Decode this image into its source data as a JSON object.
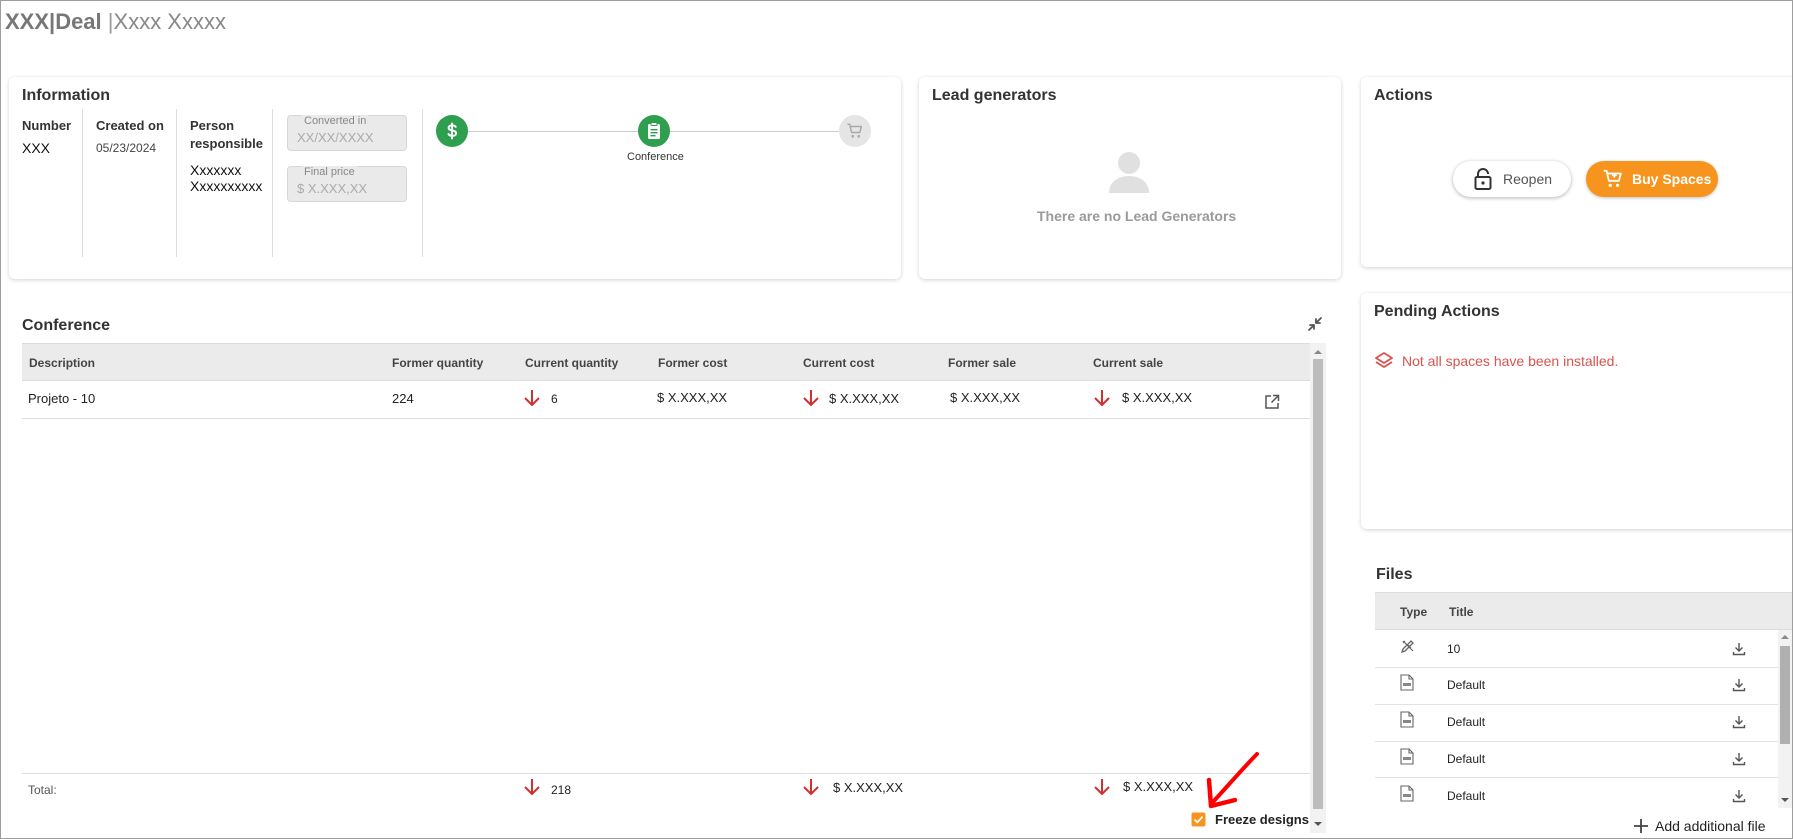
{
  "header": {
    "code": "XXX|",
    "deal": "Deal",
    "separator": "|",
    "client": "Xxxx Xxxxx"
  },
  "information": {
    "title": "Information",
    "number_label": "Number",
    "number_value": "XXX",
    "created_label": "Created on",
    "created_value": "05/23/2024",
    "person_label_1": "Person",
    "person_label_2": "responsible",
    "person_value_1": "Xxxxxxx",
    "person_value_2": "Xxxxxxxxxx",
    "converted_label": "Converted in",
    "converted_value": "XX/XX/XXXX",
    "final_label": "Final price",
    "final_value": "$ X.XXX,XX",
    "stepper": {
      "steps": [
        {
          "icon": "dollar-icon",
          "state": "active"
        },
        {
          "icon": "clipboard-icon",
          "state": "active",
          "label": "Conference"
        },
        {
          "icon": "cart-icon",
          "state": "inactive"
        }
      ],
      "active_color": "#2e9e4f"
    }
  },
  "lead_generators": {
    "title": "Lead generators",
    "empty_icon": "person-icon",
    "empty_text": "There are no Lead Generators"
  },
  "actions": {
    "title": "Actions",
    "reopen_label": "Reopen",
    "reopen_icon": "lock-open-icon",
    "buy_label": "Buy Spaces",
    "buy_icon": "cart-icon",
    "buy_color": "#f7941d"
  },
  "pending_actions": {
    "title": "Pending Actions",
    "items": [
      {
        "icon": "layers-icon",
        "text": "Not all spaces have been installed.",
        "color": "#d9534f"
      }
    ]
  },
  "conference": {
    "title": "Conference",
    "collapse_icon": "collapse-icon",
    "columns": [
      "Description",
      "Former quantity",
      "Current quantity",
      "Former cost",
      "Current cost",
      "Former sale",
      "Current sale"
    ],
    "rows": [
      {
        "description": "Projeto - 10",
        "former_quantity": "224",
        "current_quantity": "6",
        "former_cost": "$ X.XXX,XX",
        "current_cost": "$ X.XXX,XX",
        "former_sale": "$ X.XXX,XX",
        "current_sale": "$ X.XXX,XX",
        "action_icon": "open-external-icon"
      }
    ],
    "total_label": "Total:",
    "total_current_quantity": "218",
    "total_current_cost": "$ X.XXX,XX",
    "total_current_sale": "$ X.XXX,XX",
    "decrease_icon": "arrow-down-icon",
    "decrease_color": "#d32f2f",
    "freeze_label": "Freeze designs",
    "freeze_checked": true,
    "checkbox_color": "#f7941d"
  },
  "files": {
    "title": "Files",
    "columns": [
      "Type",
      "Title"
    ],
    "rows": [
      {
        "type_icon": "pencil-ruler-icon",
        "title": "10"
      },
      {
        "type_icon": "pdf-file-icon",
        "title": "Default"
      },
      {
        "type_icon": "pdf-file-icon",
        "title": "Default"
      },
      {
        "type_icon": "pdf-file-icon",
        "title": "Default"
      },
      {
        "type_icon": "pdf-file-icon",
        "title": "Default"
      }
    ],
    "download_icon": "download-icon",
    "add_label": "Add additional file",
    "add_icon": "plus-icon"
  },
  "annotation": {
    "icon": "red-arrow-icon",
    "color": "#ff0000"
  }
}
